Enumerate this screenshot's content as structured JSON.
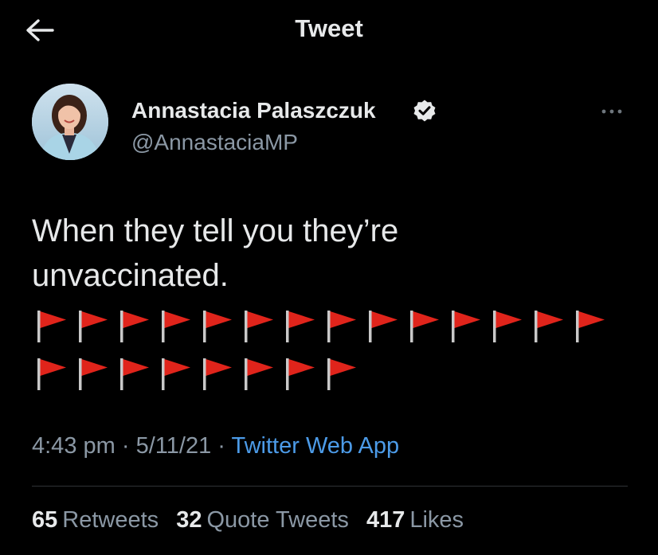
{
  "header": {
    "title": "Tweet",
    "back_icon": "arrow-left-icon"
  },
  "author": {
    "name": "Annastacia Palaszczuk",
    "handle": "@AnnastaciaMP",
    "verified": true,
    "verified_icon": "verified-badge-icon",
    "more_icon": "more-horizontal-icon"
  },
  "tweet": {
    "line1": "When they tell you they’re",
    "line2": "unvaccinated.",
    "emoji_icon": "triangular-flag-icon",
    "emoji_count": 22,
    "emoji_rows": [
      14,
      8
    ]
  },
  "meta": {
    "time": "4:43 pm",
    "separator": "·",
    "date": "5/11/21",
    "source": "Twitter Web App"
  },
  "stats": [
    {
      "count": "65",
      "label": "Retweets"
    },
    {
      "count": "32",
      "label": "Quote Tweets"
    },
    {
      "count": "417",
      "label": "Likes"
    }
  ],
  "colors": {
    "background": "#000000",
    "text": "#e7e9ea",
    "secondary": "#8b98a5",
    "link": "#4c9be8",
    "flag": "#e0241b"
  }
}
